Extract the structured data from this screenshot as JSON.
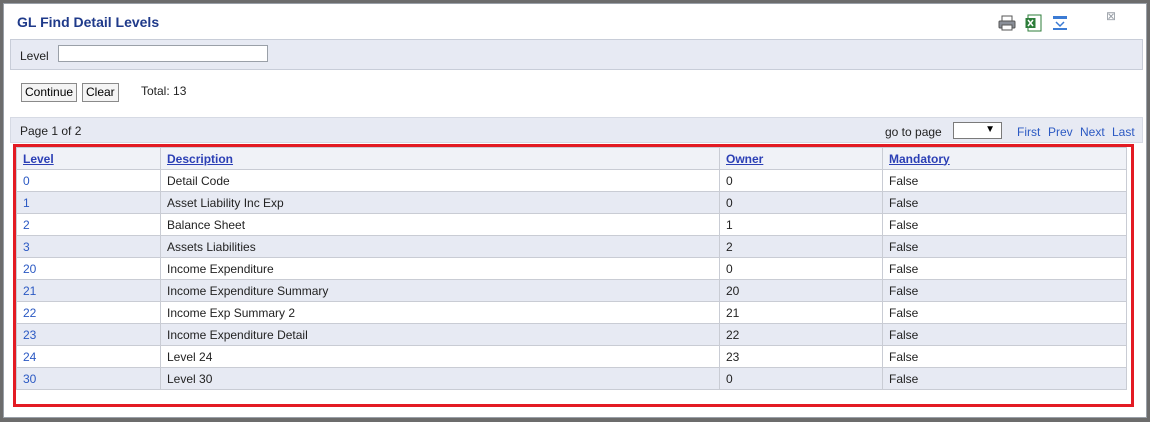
{
  "window": {
    "title": "GL Find Detail Levels"
  },
  "filter": {
    "label": "Level",
    "value": "",
    "placeholder": ""
  },
  "buttons": {
    "continue": "Continue",
    "clear": "Clear"
  },
  "total": "Total: 13",
  "pager": {
    "page_info": "Page 1 of 2",
    "goto_label": "go to page",
    "first": "First",
    "prev": "Prev",
    "next": "Next",
    "last": "Last"
  },
  "table": {
    "headers": [
      "Level",
      "Description",
      "Owner",
      "Mandatory"
    ],
    "rows": [
      [
        "0",
        "Detail Code",
        "0",
        "False"
      ],
      [
        "1",
        "Asset Liability Inc Exp",
        "0",
        "False"
      ],
      [
        "2",
        "Balance Sheet",
        "1",
        "False"
      ],
      [
        "3",
        "Assets Liabilities",
        "2",
        "False"
      ],
      [
        "20",
        "Income Expenditure",
        "0",
        "False"
      ],
      [
        "21",
        "Income Expenditure Summary",
        "20",
        "False"
      ],
      [
        "22",
        "Income Exp Summary 2",
        "21",
        "False"
      ],
      [
        "23",
        "Income Expenditure Detail",
        "22",
        "False"
      ],
      [
        "24",
        "Level 24",
        "23",
        "False"
      ],
      [
        "30",
        "Level 30",
        "0",
        "False"
      ]
    ]
  },
  "icons": [
    "print-icon",
    "excel-icon",
    "filter-toggle-icon",
    "close-icon"
  ],
  "colors": {
    "title": "#1f3a8a",
    "link": "#2b59c3",
    "highlight": "#e31b23",
    "band": "#e7eaf3"
  }
}
